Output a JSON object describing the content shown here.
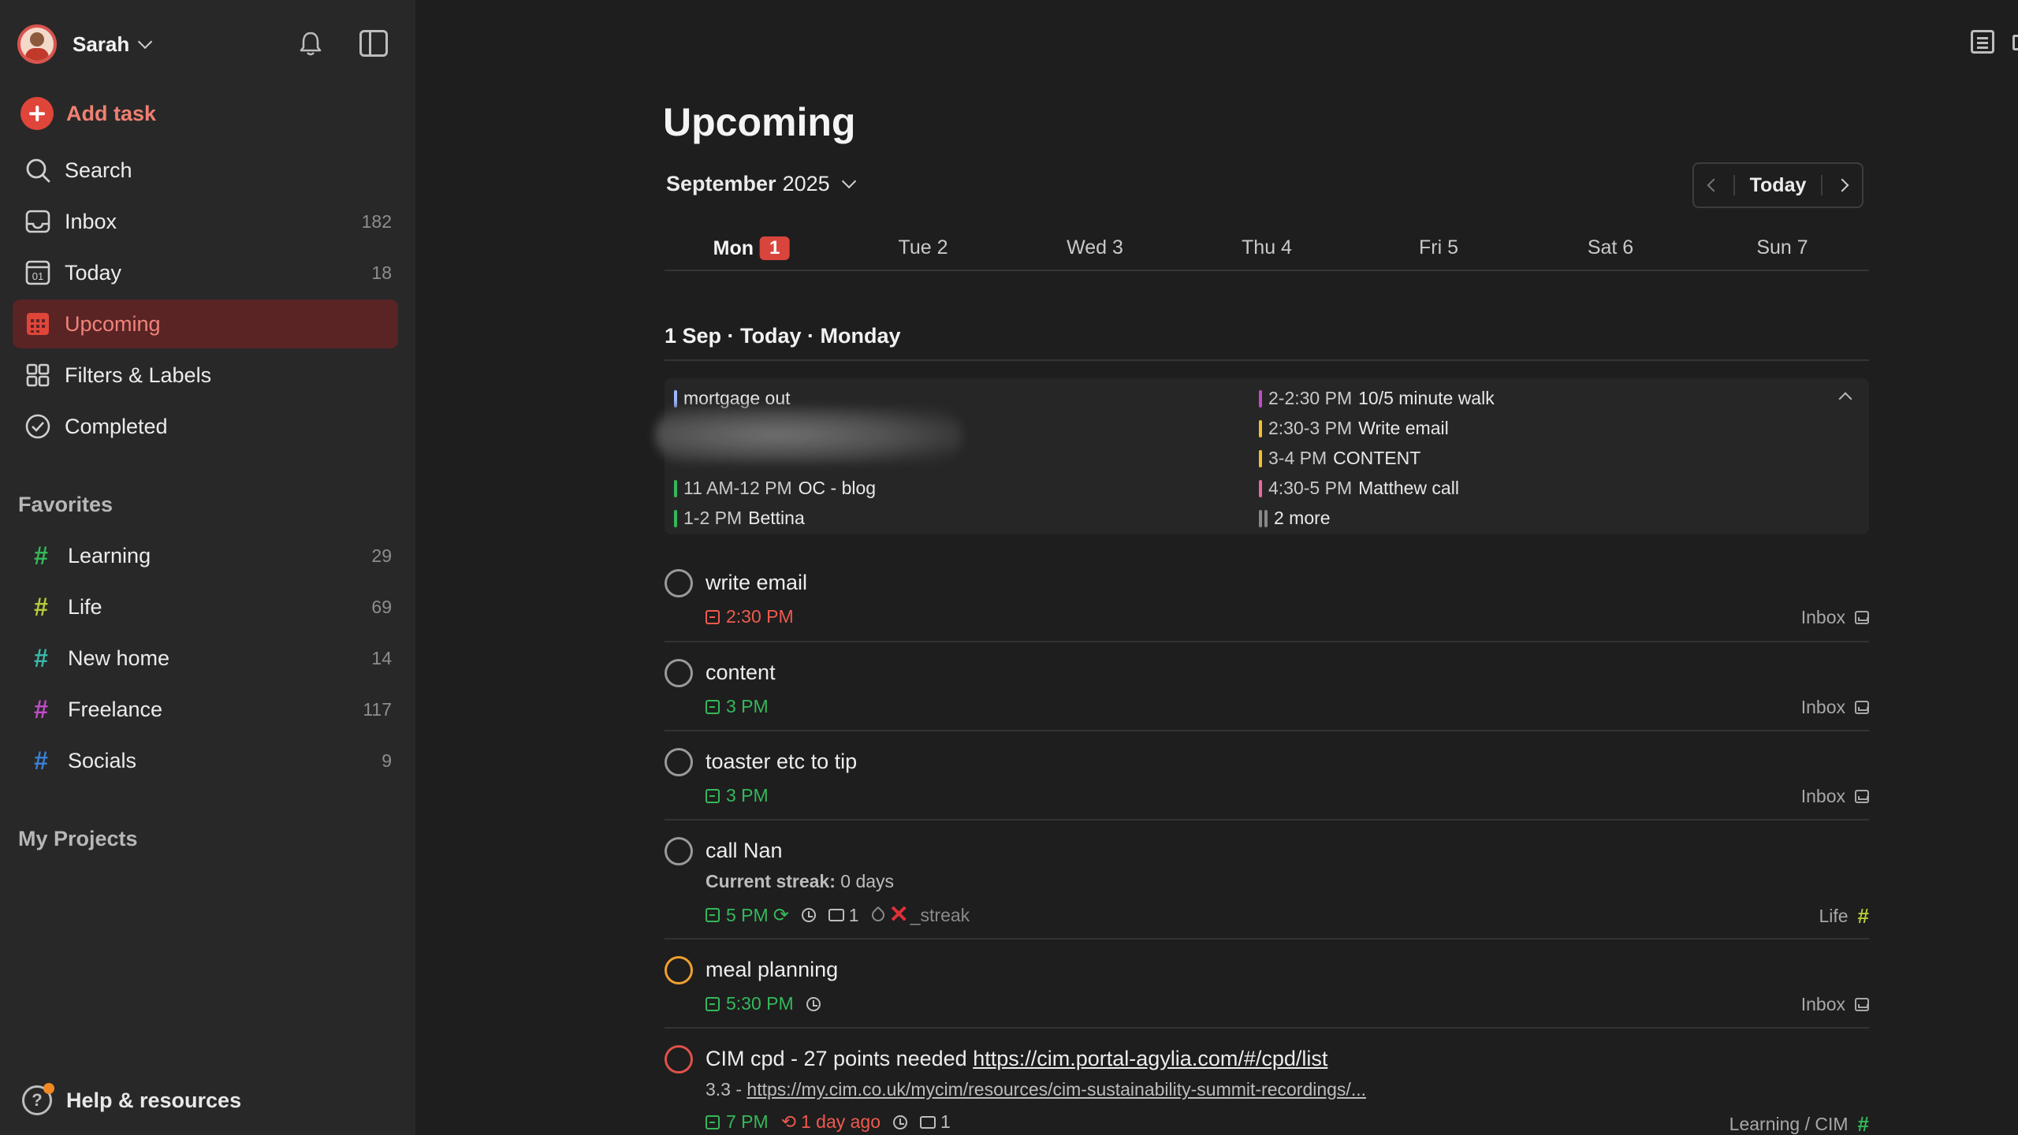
{
  "user": {
    "name": "Sarah"
  },
  "sidebar": {
    "add_task": "Add task",
    "nav": [
      {
        "label": "Search",
        "count": ""
      },
      {
        "label": "Inbox",
        "count": "182"
      },
      {
        "label": "Today",
        "count": "18",
        "icon_text": "01"
      },
      {
        "label": "Upcoming",
        "count": ""
      },
      {
        "label": "Filters & Labels",
        "count": ""
      },
      {
        "label": "Completed",
        "count": ""
      }
    ],
    "favorites_title": "Favorites",
    "favorites": [
      {
        "label": "Learning",
        "count": "29",
        "color": "#35b85a"
      },
      {
        "label": "Life",
        "count": "69",
        "color": "#b7c93a"
      },
      {
        "label": "New home",
        "count": "14",
        "color": "#3ab8a8"
      },
      {
        "label": "Freelance",
        "count": "117",
        "color": "#c04cc8"
      },
      {
        "label": "Socials",
        "count": "9",
        "color": "#3a7fd8"
      }
    ],
    "projects_title": "My Projects",
    "help": "Help & resources"
  },
  "main": {
    "title": "Upcoming",
    "month_bold": "September",
    "month_year": "2025",
    "today_button": "Today",
    "days": [
      {
        "name": "Mon",
        "badge": "1"
      },
      {
        "name": "Tue 2"
      },
      {
        "name": "Wed 3"
      },
      {
        "name": "Thu 4"
      },
      {
        "name": "Fri 5"
      },
      {
        "name": "Sat 6"
      },
      {
        "name": "Sun 7"
      }
    ],
    "day_header": "1 Sep · Today · Monday",
    "events_left": [
      {
        "time": "",
        "title": "mortgage out",
        "color": "#9fb6ff"
      },
      {
        "time": "11 AM-12 PM",
        "title": "OC - blog",
        "color": "#35b85a"
      },
      {
        "time": "1-2 PM",
        "title": "Bettina",
        "color": "#35b85a"
      }
    ],
    "events_right": [
      {
        "time": "2-2:30 PM",
        "title": "10/5 minute walk",
        "color": "#c04cc8"
      },
      {
        "time": "2:30-3 PM",
        "title": "Write email",
        "color": "#f0c030"
      },
      {
        "time": "3-4 PM",
        "title": "CONTENT",
        "color": "#f0c030"
      },
      {
        "time": "4:30-5 PM",
        "title": "Matthew call",
        "color": "#e86aa0"
      },
      {
        "time": "",
        "title": "2 more",
        "color": "#888888"
      }
    ],
    "tasks": [
      {
        "title": "write email",
        "time": "2:30 PM",
        "project": "Inbox"
      },
      {
        "title": "content",
        "time": "3 PM",
        "project": "Inbox"
      },
      {
        "title": "toaster etc to tip",
        "time": "3 PM",
        "project": "Inbox"
      },
      {
        "title": "call Nan",
        "streak_label": "Current streak:",
        "streak_value": "0 days",
        "time": "5 PM",
        "comments": "1",
        "label": "_streak",
        "project": "Life"
      },
      {
        "title": "meal planning",
        "time": "5:30 PM",
        "project": "Inbox"
      },
      {
        "title": "CIM cpd - 27 points needed",
        "link": "https://cim.portal-agylia.com/#/cpd/list",
        "desc_prefix": "3.3 - ",
        "desc_link": "https://my.cim.co.uk/mycim/resources/cim-sustainability-summit-recordings/...",
        "time": "7 PM",
        "overdue": "1 day ago",
        "comments": "1",
        "project": "Learning / CIM"
      }
    ]
  }
}
